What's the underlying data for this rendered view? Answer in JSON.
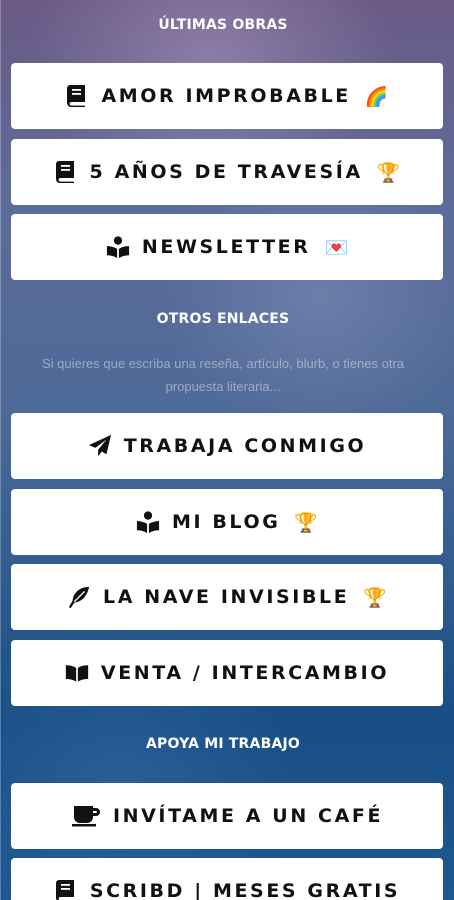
{
  "sections": {
    "works_title": "ÚLTIMAS OBRAS",
    "links_title": "OTROS ENLACES",
    "links_description": "Si quieres que escriba una reseña, artículo, blurb, o tienes otra propuesta literaria...",
    "support_title": "APOYA MI TRABAJO"
  },
  "buttons": [
    {
      "label": "AMOR IMPROBABLE",
      "emoji": "🌈",
      "icon": "book-icon"
    },
    {
      "label": "5 AÑOS DE TRAVESÍA",
      "emoji": "🏆",
      "icon": "book-icon"
    },
    {
      "label": "NEWSLETTER",
      "emoji": "💌",
      "icon": "book-reader-icon"
    },
    {
      "label": "TRABAJA CONMIGO",
      "emoji": "",
      "icon": "paper-plane-icon"
    },
    {
      "label": "MI BLOG",
      "emoji": "🏆",
      "icon": "book-reader-icon"
    },
    {
      "label": "LA NAVE INVISIBLE",
      "emoji": "🏆",
      "icon": "feather-icon"
    },
    {
      "label": "VENTA / INTERCAMBIO",
      "emoji": "",
      "icon": "open-book-icon"
    },
    {
      "label": "INVÍTAME A UN CAFÉ",
      "emoji": "",
      "icon": "coffee-icon"
    },
    {
      "label": "SCRIBD | MESES GRATIS",
      "emoji": "",
      "icon": "book-icon"
    }
  ],
  "colors": {
    "button_bg": "#ffffff",
    "button_text": "#111111",
    "section_title": "#ffffff"
  }
}
